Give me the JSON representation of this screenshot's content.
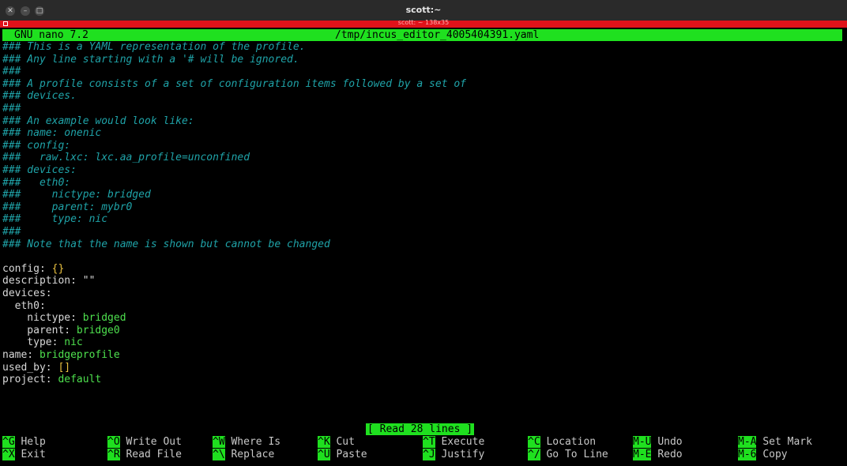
{
  "window": {
    "title": "scott:~",
    "tab_label": "scott: ~ 138x35",
    "close_glyph": "✕",
    "minimize_glyph": "–",
    "maximize_glyph": "□"
  },
  "nano": {
    "app_version": "GNU nano 7.2",
    "filename": "/tmp/incus_editor_4005404391.yaml",
    "status": "[ Read 28 lines ]"
  },
  "comments": [
    "### This is a YAML representation of the profile.",
    "### Any line starting with a '# will be ignored.",
    "###",
    "### A profile consists of a set of configuration items followed by a set of",
    "### devices.",
    "###",
    "### An example would look like:",
    "### name: onenic",
    "### config:",
    "###   raw.lxc: lxc.aa_profile=unconfined",
    "### devices:",
    "###   eth0:",
    "###     nictype: bridged",
    "###     parent: mybr0",
    "###     type: nic",
    "###",
    "### Note that the name is shown but cannot be changed"
  ],
  "yaml": {
    "config_key": "config:",
    "config_val": "{}",
    "description_key": "description:",
    "description_val": "\"\"",
    "devices_key": "devices:",
    "eth0_key": "  eth0:",
    "nictype_key": "    nictype:",
    "nictype_val": "bridged",
    "parent_key": "    parent:",
    "parent_val": "bridge0",
    "type_key": "    type:",
    "type_val": "nic",
    "name_key": "name:",
    "name_val": "bridgeprofile",
    "used_by_key": "used_by:",
    "used_by_val": "[]",
    "project_key": "project:",
    "project_val": "default"
  },
  "shortcuts": [
    {
      "key": "^G",
      "label": "Help"
    },
    {
      "key": "^X",
      "label": "Exit"
    },
    {
      "key": "^O",
      "label": "Write Out"
    },
    {
      "key": "^R",
      "label": "Read File"
    },
    {
      "key": "^W",
      "label": "Where Is"
    },
    {
      "key": "^\\",
      "label": "Replace"
    },
    {
      "key": "^K",
      "label": "Cut"
    },
    {
      "key": "^U",
      "label": "Paste"
    },
    {
      "key": "^T",
      "label": "Execute"
    },
    {
      "key": "^J",
      "label": "Justify"
    },
    {
      "key": "^C",
      "label": "Location"
    },
    {
      "key": "^/",
      "label": "Go To Line"
    },
    {
      "key": "M-U",
      "label": "Undo"
    },
    {
      "key": "M-E",
      "label": "Redo"
    },
    {
      "key": "M-A",
      "label": "Set Mark"
    },
    {
      "key": "M-6",
      "label": "Copy"
    }
  ],
  "colors": {
    "header_bg": "#1fe01f",
    "comment": "#1fa3a8",
    "value": "#4ee04e",
    "tab_bar": "#e0121a"
  }
}
